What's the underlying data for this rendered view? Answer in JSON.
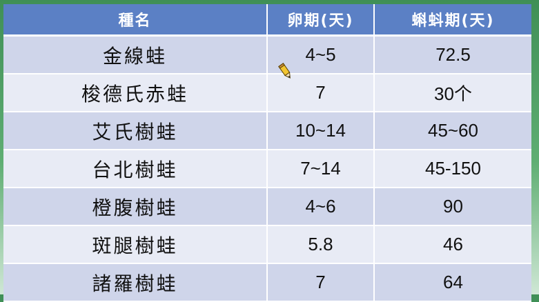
{
  "table": {
    "headers": [
      "種名",
      "卵期(天)",
      "蝌蚪期(天)"
    ],
    "rows": [
      [
        "金線蛙",
        "4~5",
        "72.5"
      ],
      [
        "梭德氏赤蛙",
        "7",
        "30个"
      ],
      [
        "艾氏樹蛙",
        "10~14",
        "45~60"
      ],
      [
        "台北樹蛙",
        "7~14",
        "45-150"
      ],
      [
        "橙腹樹蛙",
        "4~6",
        "90"
      ],
      [
        "斑腿樹蛙",
        "5.8",
        "46"
      ],
      [
        "諸羅樹蛙",
        "7",
        "64"
      ]
    ]
  },
  "colors": {
    "header_bg": "#5b80c5",
    "row_dark": "#cfd5ea",
    "row_light": "#e8ebf5",
    "background": "#4f9e64"
  },
  "icons": {
    "cursor": "pencil-icon"
  }
}
